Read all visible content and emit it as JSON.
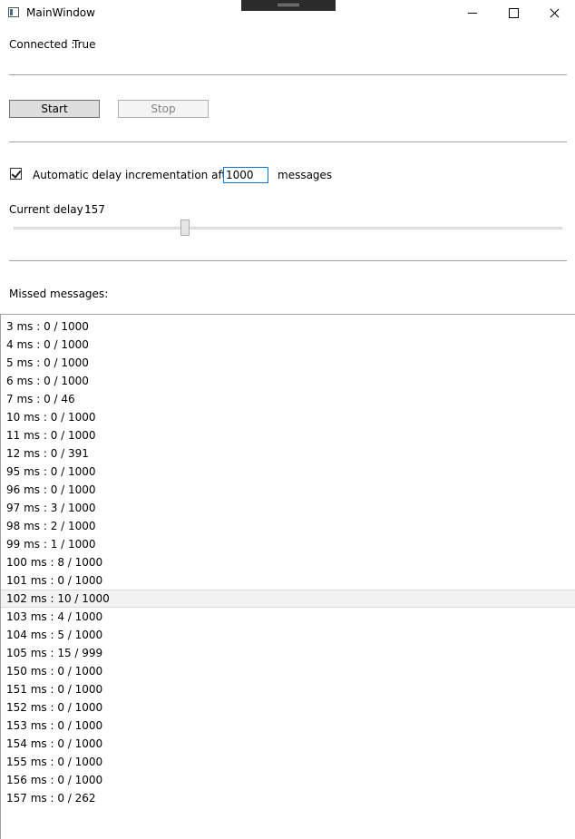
{
  "window": {
    "title": "MainWindow"
  },
  "status": {
    "connected_label": "Connected :",
    "connected_value": "True"
  },
  "controls": {
    "start_label": "Start",
    "stop_label": "Stop"
  },
  "delay": {
    "auto_label": "Automatic delay incrementation after",
    "auto_checked": true,
    "message_count": "1000",
    "messages_label": "messages",
    "current_label": "Current delay :",
    "current_value": "157",
    "slider_fraction": 0.31
  },
  "missed": {
    "label": "Missed messages:",
    "items": [
      "3  ms :  0  /  1000",
      "4  ms :  0  /  1000",
      "5  ms :  0  /  1000",
      "6  ms :  0  /  1000",
      "7  ms :  0  /  46",
      "10  ms :  0  /  1000",
      "11  ms :  0  /  1000",
      "12  ms :  0  /  391",
      "95  ms :  0  /  1000",
      "96  ms :  0  /  1000",
      "97  ms :  3  /  1000",
      "98  ms :  2  /  1000",
      "99  ms :  1  /  1000",
      "100  ms :  8  /  1000",
      "101  ms :  0  /  1000",
      "102  ms :  10  /  1000",
      "103  ms :  4  /  1000",
      "104  ms :  5  /  1000",
      "105  ms :  15  /  999",
      "150  ms :  0  /  1000",
      "151  ms :  0  /  1000",
      "152  ms :  0  /  1000",
      "153  ms :  0  /  1000",
      "154  ms :  0  /  1000",
      "155  ms :  0  /  1000",
      "156  ms :  0  /  1000",
      "157  ms :  0  /  262"
    ],
    "selected_index": 15
  }
}
